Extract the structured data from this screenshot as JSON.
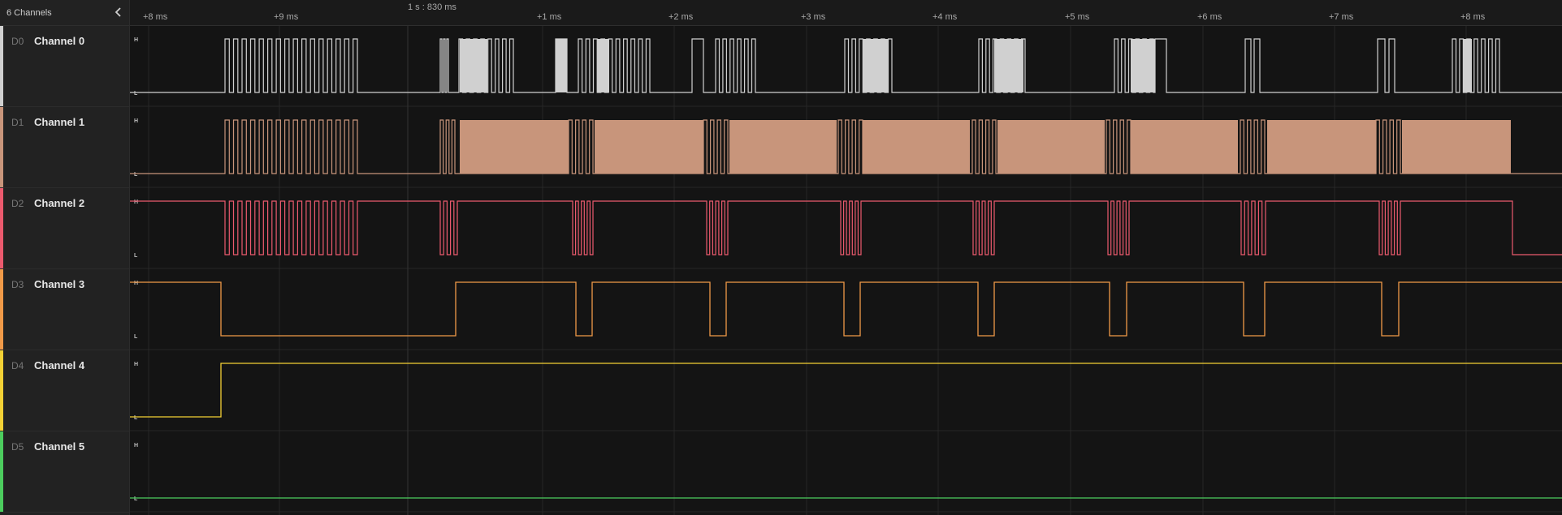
{
  "sidebar": {
    "title": "6 Channels",
    "collapse_icon": "chevron-left-icon"
  },
  "channels": [
    {
      "id": "D0",
      "name": "Channel 0",
      "color": "#d0d0d0"
    },
    {
      "id": "D1",
      "name": "Channel 1",
      "color": "#c8957b"
    },
    {
      "id": "D2",
      "name": "Channel 2",
      "color": "#ec5a6e"
    },
    {
      "id": "D3",
      "name": "Channel 3",
      "color": "#f09a48"
    },
    {
      "id": "D4",
      "name": "Channel 4",
      "color": "#f3d135"
    },
    {
      "id": "D5",
      "name": "Channel 5",
      "color": "#4ccd5e"
    }
  ],
  "level_labels": {
    "high": "H",
    "low": "L"
  },
  "timeline": {
    "trigger_label": "1 s : 830 ms",
    "ticks": [
      "+8 ms",
      "+9 ms",
      "+1 ms",
      "+2 ms",
      "+3 ms",
      "+4 ms",
      "+5 ms",
      "+6 ms",
      "+7 ms",
      "+8 ms"
    ]
  }
}
